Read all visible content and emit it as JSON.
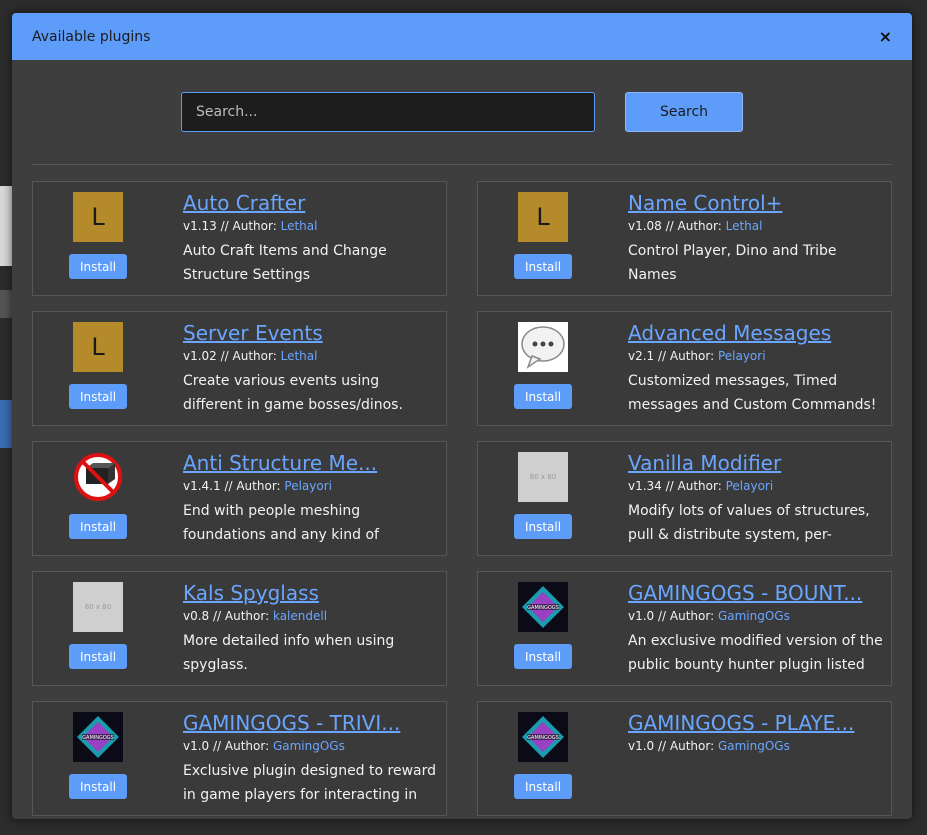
{
  "modal": {
    "title": "Available plugins",
    "close_label": "×"
  },
  "search": {
    "placeholder": "Search...",
    "button_label": "Search"
  },
  "install_label": "Install",
  "plugins": [
    {
      "name": "Auto Crafter",
      "version": "v1.13 // Author: ",
      "author": "Lethal",
      "description": "Auto Craft Items and Change Structure Settings",
      "icon": "lethal-logo-icon"
    },
    {
      "name": "Name Control+",
      "version": "v1.08 // Author: ",
      "author": "Lethal",
      "description": "Control Player, Dino and Tribe Names",
      "icon": "lethal-logo-icon"
    },
    {
      "name": "Server Events",
      "version": "v1.02 // Author: ",
      "author": "Lethal",
      "description": "Create various events using different in game bosses/dinos.",
      "icon": "lethal-logo-icon"
    },
    {
      "name": "Advanced Messages",
      "version": "v2.1 // Author: ",
      "author": "Pelayori",
      "description": "Customized messages, Timed messages and Custom Commands!",
      "icon": "chat-bubble-icon"
    },
    {
      "name": "Anti Structure Me...",
      "version": "v1.4.1 // Author: ",
      "author": "Pelayori",
      "description": "End with people meshing foundations and any kind of",
      "icon": "no-structure-icon"
    },
    {
      "name": "Vanilla Modifier",
      "version": "v1.34 // Author: ",
      "author": "Pelayori",
      "description": "Modify lots of values of structures, pull & distribute system, per-",
      "icon": "placeholder-image-icon"
    },
    {
      "name": "Kals Spyglass",
      "version": "v0.8 // Author: ",
      "author": "kalendell",
      "description": "More detailed info when using spyglass.",
      "icon": "placeholder-image-icon"
    },
    {
      "name": "GAMINGOGS - BOUNT...",
      "version": "v1.0 // Author: ",
      "author": "GamingOGs",
      "description": "An exclusive modified version of the public bounty hunter plugin listed on",
      "icon": "gamingogs-logo-icon"
    },
    {
      "name": "GAMINGOGS - TRIVI...",
      "version": "v1.0 // Author: ",
      "author": "GamingOGs",
      "description": "Exclusive plugin designed to reward in game players for interacting in",
      "icon": "gamingogs-logo-icon"
    },
    {
      "name": "GAMINGOGS - PLAYE...",
      "version": "v1.0 // Author: ",
      "author": "GamingOGs",
      "description": "",
      "icon": "gamingogs-logo-icon"
    }
  ],
  "thumb_text": {
    "lethal": "L",
    "placeholder": "80 x 80"
  },
  "colors": {
    "accent": "#5d9cf8",
    "link": "#6aa6ff",
    "modal_bg": "#3e3e3e",
    "lethal_logo": "#b58a2b"
  }
}
